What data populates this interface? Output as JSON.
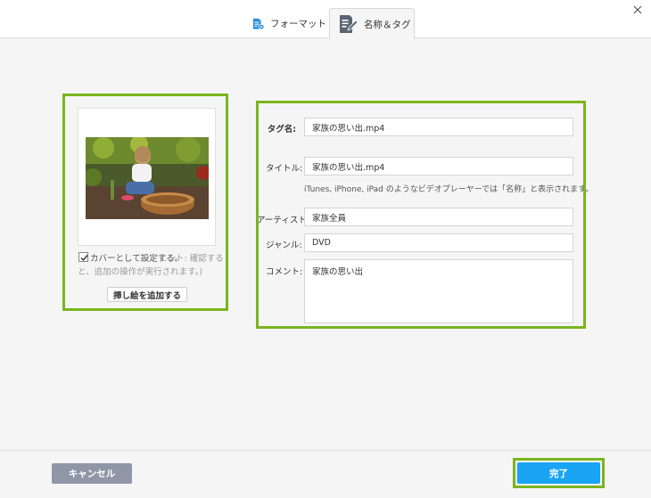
{
  "tabs": {
    "format_label": "フォーマット",
    "name_tag_label": "名称＆タグ"
  },
  "cover": {
    "set_as_cover_label": "カバーとして設定する。",
    "hint_line1": "ヒント: 確認する",
    "hint_line2": "と、追加の操作が実行されます。)",
    "checked": true,
    "add_artwork_label": "挿し絵を追加する"
  },
  "fields": {
    "tag_name_label": "タグ名:",
    "tag_name_value": "家族の思い出.mp4",
    "title_label": "タイトル:",
    "title_value": "家族の思い出.mp4",
    "title_note": "iTunes, iPhone, iPad のようなビデオプレーヤーでは「名称」と表示されます。",
    "artist_label": "アーティスト:",
    "artist_value": "家族全員",
    "genre_label": "ジャンル:",
    "genre_value": "DVD",
    "comment_label": "コメント:",
    "comment_value": "家族の思い出"
  },
  "footer": {
    "cancel_label": "キャンセル",
    "done_label": "完了"
  },
  "colors": {
    "highlight_border": "#7ab51d",
    "done_button": "#1aa4f4",
    "cancel_button": "#8f97a7",
    "icon_blue": "#2e8fd8",
    "icon_gray": "#5b6470"
  }
}
